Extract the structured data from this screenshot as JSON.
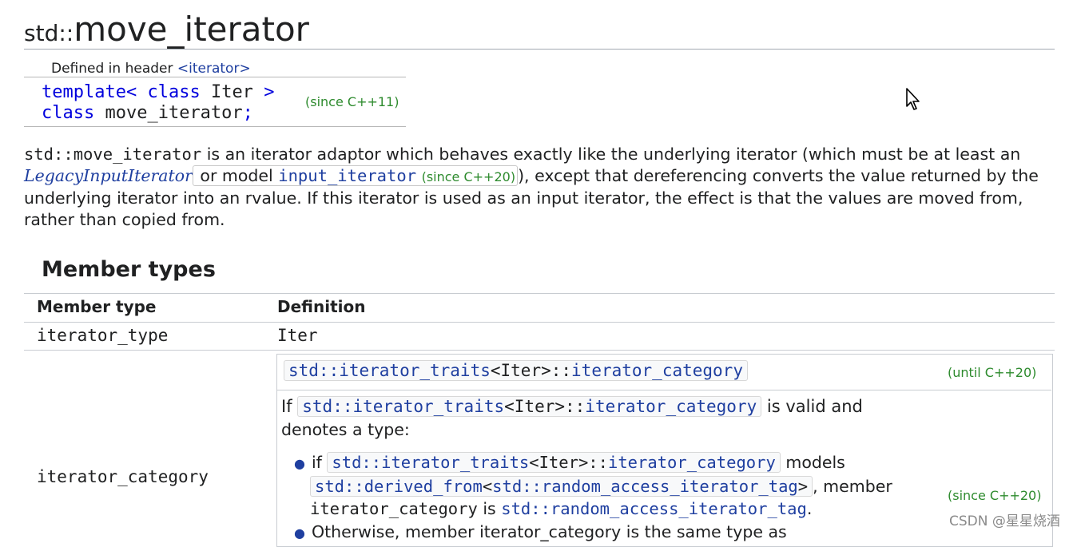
{
  "title": {
    "ns": "std::",
    "name": "move_iterator"
  },
  "header_line": {
    "prefix": "Defined in header ",
    "header": "<iterator>"
  },
  "declaration": {
    "kw1": "template",
    "open": "<",
    "kw2": "class",
    "param": " Iter ",
    "close": ">",
    "kw3": "class",
    "rest": " move_iterator",
    "semi": ";",
    "since": "(since C++11)"
  },
  "paragraph": {
    "code1": "std::move_iterator",
    "t1": " is an iterator adaptor which behaves exactly like the underlying iterator (which must be at least an ",
    "link1": "LegacyInputIterator",
    "t2": " or model ",
    "code2": "input_iterator",
    "since": "(since C++20)",
    "t3": "), except that dereferencing converts the value returned by the underlying iterator into an rvalue. If this iterator is used as an input iterator, the effect is that the values are moved from, rather than copied from."
  },
  "section": {
    "heading": "Member types"
  },
  "table": {
    "headers": [
      "Member type",
      "Definition"
    ],
    "row1": {
      "type": "iterator_type",
      "def": "Iter"
    },
    "row2": {
      "type": "iterator_category",
      "def1": {
        "a": "std::iterator_traits",
        "b": "<Iter>::",
        "c": "iterator_category"
      },
      "until": "(until C++20)",
      "def2": {
        "if": "If ",
        "a": "std::iterator_traits",
        "b": "<Iter>::",
        "c": "iterator_category",
        "after": " is valid and",
        "line2": "denotes a type:"
      },
      "bullet1": {
        "if": "if ",
        "a": "std::iterator_traits",
        "b": "<Iter>::",
        "c": "iterator_category",
        "models": " models",
        "d1": "std::derived_from",
        "d2": "<",
        "d3": "std::random_access_iterator_tag",
        "d4": ">",
        "member": ", member",
        "e": "iterator_category",
        "is": " is ",
        "f": "std::random_access_iterator_tag",
        "period": "."
      },
      "bullet2": "Otherwise, member iterator_category is the same type as",
      "since": "(since C++20)"
    }
  },
  "watermark": "CSDN @星星烧酒"
}
